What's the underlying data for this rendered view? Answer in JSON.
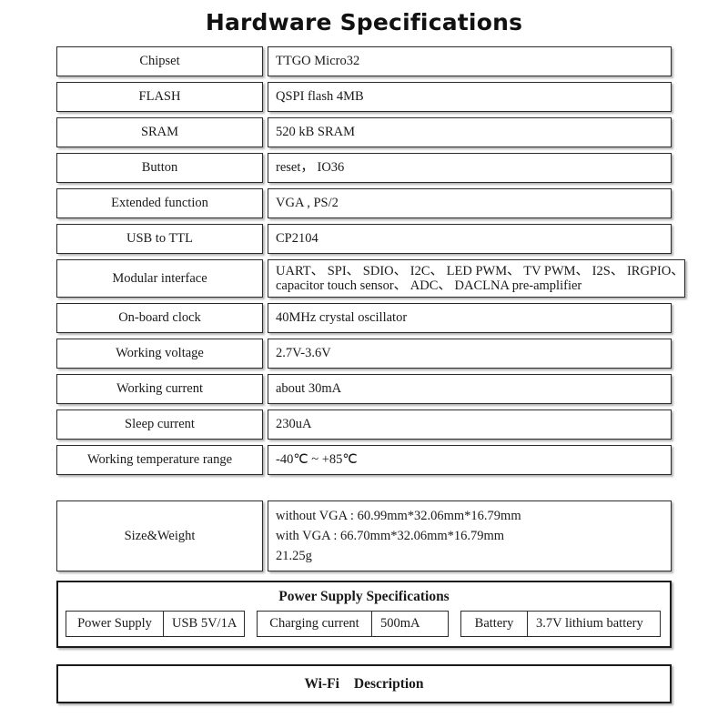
{
  "document": {
    "title": "Hardware Specifications"
  },
  "spec_table": {
    "rows": [
      {
        "label": "Chipset",
        "value": "TTGO Micro32"
      },
      {
        "label": "FLASH",
        "value": "QSPI flash 4MB"
      },
      {
        "label": "SRAM",
        "value": "520 kB SRAM"
      },
      {
        "label": "Button",
        "value": "reset， IO36"
      },
      {
        "label": "Extended function",
        "value": "VGA , PS/2"
      },
      {
        "label": "USB to TTL",
        "value": "CP2104"
      },
      {
        "label": "Modular interface",
        "lines": [
          "UART、 SPI、 SDIO、 I2C、 LED PWM、 TV PWM、 I2S、 IRGPIO、",
          "capacitor touch sensor、 ADC、 DACLNA  pre-amplifier"
        ]
      },
      {
        "label": "On-board clock",
        "value": "40MHz crystal oscillator"
      },
      {
        "label": "Working voltage",
        "value": "2.7V-3.6V"
      },
      {
        "label": "Working current",
        "value": "about 30mA"
      },
      {
        "label": "Sleep current",
        "value": "230uA"
      },
      {
        "label": "Working temperature range",
        "value": "-40℃ ~ +85℃"
      }
    ],
    "size_weight": {
      "label": "Size&Weight",
      "lines": [
        "without VGA : 60.99mm*32.06mm*16.79mm",
        "with VGA : 66.70mm*32.06mm*16.79mm",
        "21.25g"
      ]
    }
  },
  "power_supply": {
    "title": "Power Supply Specifications",
    "groups": [
      {
        "key": "Power Supply",
        "value": "USB 5V/1A"
      },
      {
        "key": "Charging current",
        "value": "500mA"
      },
      {
        "key": "Battery",
        "value": "3.7V lithium battery"
      }
    ]
  },
  "wifi": {
    "label": "Wi-Fi",
    "description": "Description"
  }
}
